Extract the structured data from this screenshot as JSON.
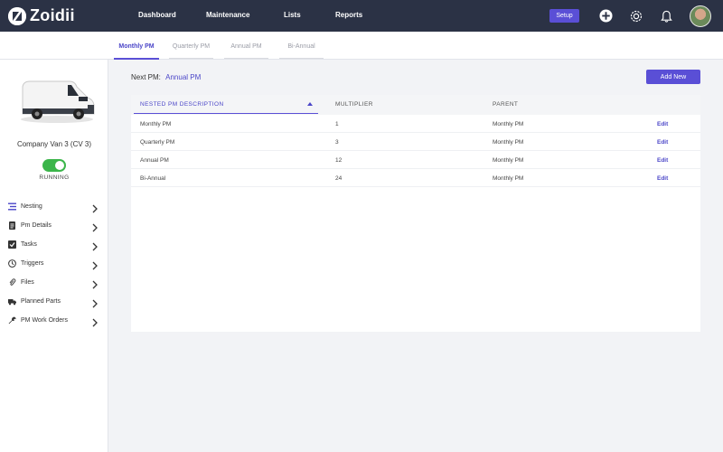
{
  "app": {
    "logo_text": "Zoidii"
  },
  "nav": {
    "dashboard": "Dashboard",
    "maintenance": "Maintenance",
    "lists": "Lists",
    "reports": "Reports",
    "setup": "Setup"
  },
  "tabs": [
    {
      "label": "Monthly PM",
      "active": true
    },
    {
      "label": "Quarterly PM",
      "active": false
    },
    {
      "label": "Annual PM",
      "active": false
    },
    {
      "label": "Bi-Annual",
      "active": false
    }
  ],
  "vehicle": {
    "name": "Company Van 3 (CV 3)",
    "status": "RUNNING",
    "running": true
  },
  "sidebar_menu": [
    {
      "label": "Nesting",
      "icon": "nesting-icon"
    },
    {
      "label": "Pm Details",
      "icon": "document-icon"
    },
    {
      "label": "Tasks",
      "icon": "checkbox-icon"
    },
    {
      "label": "Triggers",
      "icon": "clock-icon"
    },
    {
      "label": "Files",
      "icon": "paperclip-icon"
    },
    {
      "label": "Planned Parts",
      "icon": "truck-icon"
    },
    {
      "label": "PM Work Orders",
      "icon": "wrench-icon"
    }
  ],
  "main": {
    "next_pm_label": "Next PM:",
    "next_pm_value": "Annual PM",
    "add_button": "Add New"
  },
  "table": {
    "columns": [
      "NESTED PM DESCRIPTION",
      "MULTIPLIER",
      "PARENT"
    ],
    "rows": [
      {
        "description": "Monthly PM",
        "multiplier": "1",
        "parent": "Monthly PM",
        "action": "Edit"
      },
      {
        "description": "Quarterly PM",
        "multiplier": "3",
        "parent": "Monthly PM",
        "action": "Edit"
      },
      {
        "description": "Annual PM",
        "multiplier": "12",
        "parent": "Monthly PM",
        "action": "Edit"
      },
      {
        "description": "Bi-Annual",
        "multiplier": "24",
        "parent": "Monthly PM",
        "action": "Edit"
      }
    ]
  },
  "colors": {
    "topbar": "#2b3245",
    "accent": "#5a4fd6",
    "running_toggle": "#3bb54a"
  }
}
